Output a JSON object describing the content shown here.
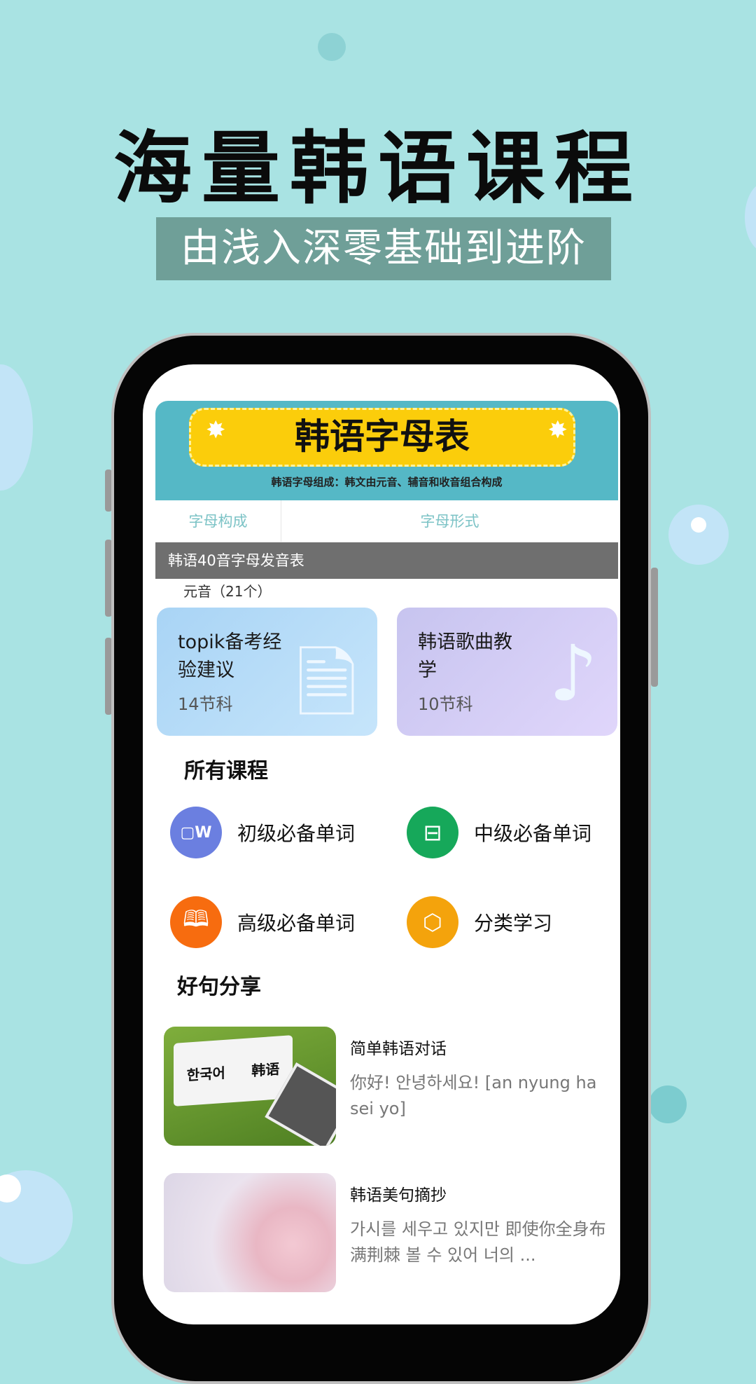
{
  "header": {
    "title": "海量韩语课程",
    "subtitle": "由浅入深零基础到进阶"
  },
  "banner": {
    "heading": "韩语字母表",
    "description": "韩语字母组成：韩文由元音、辅音和收音组合构成",
    "col1": "字母构成",
    "col2": "字母形式",
    "row_label": "元音（21个）",
    "caption": "韩语40音字母发音表"
  },
  "cards": [
    {
      "title": "topik备考经验建议",
      "count": "14节科",
      "icon": "paper-icon"
    },
    {
      "title": "韩语歌曲教学",
      "count": "10节科",
      "icon": "music-note-icon"
    }
  ],
  "all_courses": {
    "title": "所有课程",
    "items": [
      {
        "label": "初级必备单词",
        "icon": "clipboard-w-icon",
        "color": "#6b7fe0"
      },
      {
        "label": "中级必备单词",
        "icon": "note-icon",
        "color": "#16a85a"
      },
      {
        "label": "高级必备单词",
        "icon": "book-icon",
        "color": "#f76c0f"
      },
      {
        "label": "分类学习",
        "icon": "hexagons-icon",
        "color": "#f4a30c"
      }
    ]
  },
  "sentences": {
    "title": "好句分享",
    "items": [
      {
        "title": "简单韩语对话",
        "desc": "你好! 안녕하세요! [an nyung ha sei yo]",
        "img_text_1": "한국어",
        "img_text_2": "韩语"
      },
      {
        "title": "韩语美句摘抄",
        "desc": "가시를 세우고 있지만 即使你全身布满荆棘 볼 수 있어 너의 ..."
      }
    ]
  },
  "colors": {
    "background": "#a9e3e3",
    "subtitle_bg": "#6f9f98",
    "banner_teal": "#55b8c6",
    "banner_yellow": "#fbcd0b"
  }
}
